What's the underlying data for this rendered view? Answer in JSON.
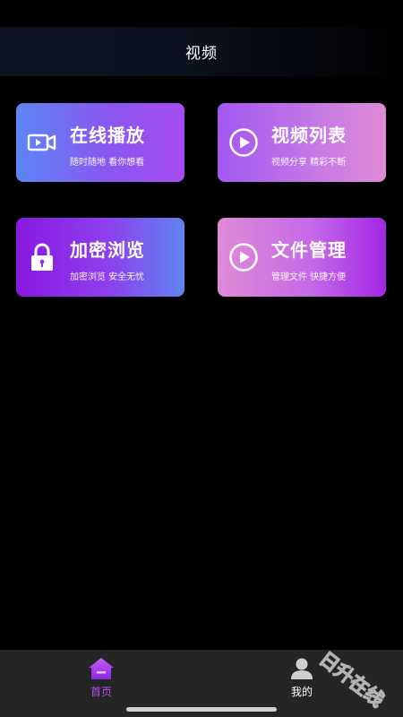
{
  "header": {
    "title": "视频"
  },
  "cards": [
    {
      "title": "在线播放",
      "subtitle": "随时随地 看你想看",
      "icon": "video-camera-icon"
    },
    {
      "title": "视频列表",
      "subtitle": "视频分享 精彩不断",
      "icon": "play-circle-icon"
    },
    {
      "title": "加密浏览",
      "subtitle": "加密浏览 安全无忧",
      "icon": "lock-icon"
    },
    {
      "title": "文件管理",
      "subtitle": "管理文件 快捷方便",
      "icon": "play-circle-icon"
    }
  ],
  "tabbar": {
    "home": {
      "label": "首页",
      "icon": "home-icon",
      "active": true
    },
    "mine": {
      "label": "我的",
      "icon": "user-icon",
      "active": false
    }
  },
  "watermark": {
    "text": "日升在线"
  },
  "colors": {
    "accent": "#b94df0",
    "background": "#000000",
    "tabbar": "#252525"
  }
}
